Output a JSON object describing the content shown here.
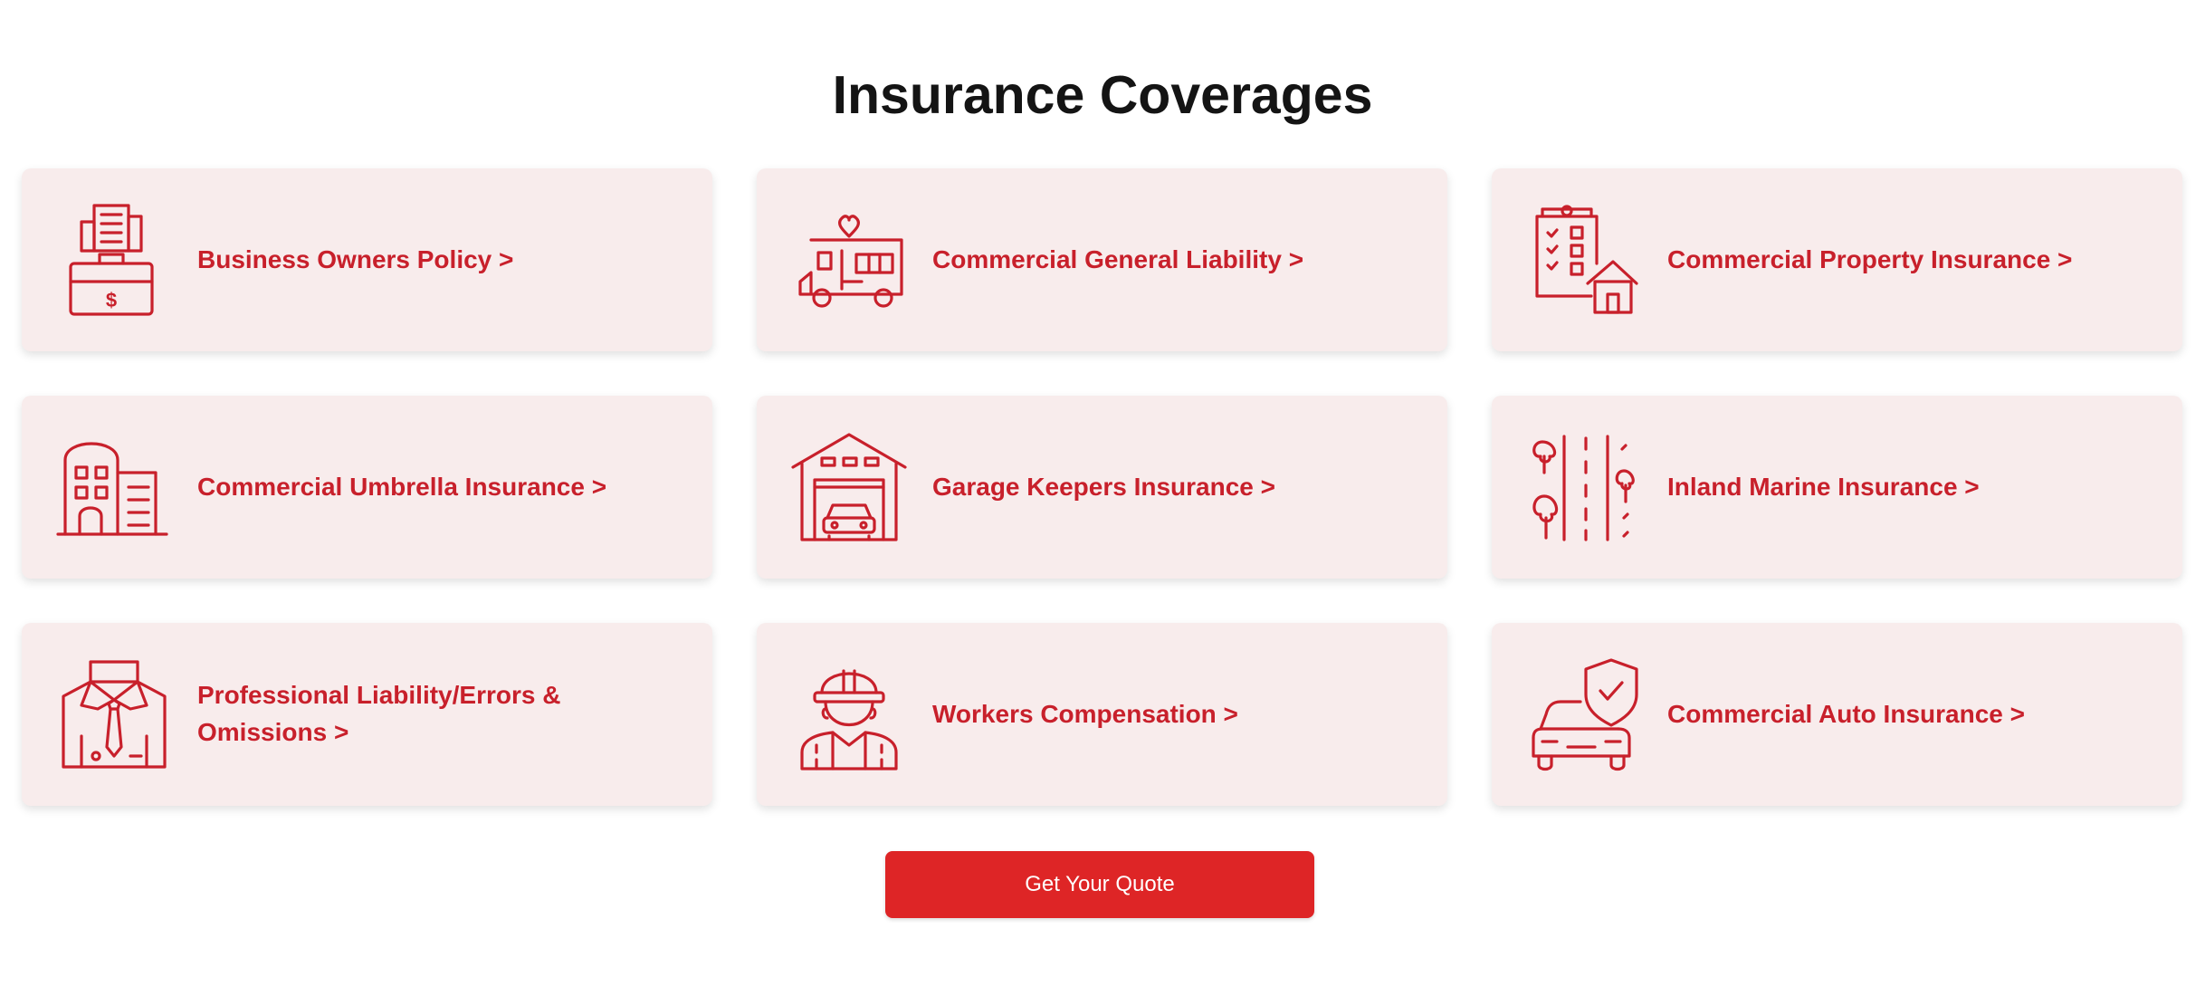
{
  "page": {
    "title": "Insurance Coverages"
  },
  "coverages": [
    {
      "label": "Business Owners Policy >",
      "icon": "briefcase-buildings-icon"
    },
    {
      "label": "Commercial General Liability >",
      "icon": "food-truck-icon"
    },
    {
      "label": "Commercial Property Insurance >",
      "icon": "checklist-house-icon"
    },
    {
      "label": "Commercial Umbrella Insurance >",
      "icon": "office-building-icon"
    },
    {
      "label": "Garage Keepers Insurance >",
      "icon": "garage-car-icon"
    },
    {
      "label": "Inland Marine Insurance >",
      "icon": "road-trees-icon"
    },
    {
      "label": "Professional Liability/Errors & Omissions >",
      "icon": "suit-tie-icon"
    },
    {
      "label": "Workers Compensation >",
      "icon": "construction-worker-icon"
    },
    {
      "label": "Commercial Auto Insurance >",
      "icon": "car-shield-icon"
    }
  ],
  "cta": {
    "label": "Get Your Quote"
  },
  "colors": {
    "accent": "#c8202b",
    "button": "#de2526",
    "card_background": "#f8ecec",
    "title": "#141414"
  }
}
